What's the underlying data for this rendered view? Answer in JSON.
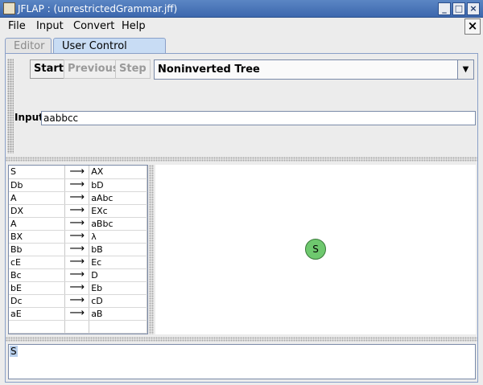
{
  "window": {
    "title": "JFLAP : (unrestrictedGrammar.jff)",
    "controls": [
      "_",
      "□",
      "×"
    ]
  },
  "menu": {
    "items": [
      "File",
      "Input",
      "Convert",
      "Help"
    ],
    "close_label": "×"
  },
  "tabs": [
    {
      "label": "Editor",
      "active": false
    },
    {
      "label": "User Control Parser",
      "active": true
    }
  ],
  "toolbar": {
    "start_label": "Start",
    "previous_label": "Previous",
    "step_label": "Step",
    "view_mode": "Noninverted Tree"
  },
  "input": {
    "label": "Input",
    "value": "aabbcc"
  },
  "grammar": {
    "arrow": "⟶",
    "rules": [
      {
        "lhs": "S",
        "rhs": "AX"
      },
      {
        "lhs": "Db",
        "rhs": "bD"
      },
      {
        "lhs": "A",
        "rhs": "aAbc"
      },
      {
        "lhs": "DX",
        "rhs": "EXc"
      },
      {
        "lhs": "A",
        "rhs": "aBbc"
      },
      {
        "lhs": "BX",
        "rhs": "λ"
      },
      {
        "lhs": "Bb",
        "rhs": "bB"
      },
      {
        "lhs": "cE",
        "rhs": "Ec"
      },
      {
        "lhs": "Bc",
        "rhs": "D"
      },
      {
        "lhs": "bE",
        "rhs": "Eb"
      },
      {
        "lhs": "Dc",
        "rhs": "cD"
      },
      {
        "lhs": "aE",
        "rhs": "aB"
      },
      {
        "lhs": "",
        "rhs": ""
      }
    ]
  },
  "tree": {
    "root_label": "S",
    "node_color": "#6ec86e"
  },
  "derivation": {
    "current": "S"
  }
}
